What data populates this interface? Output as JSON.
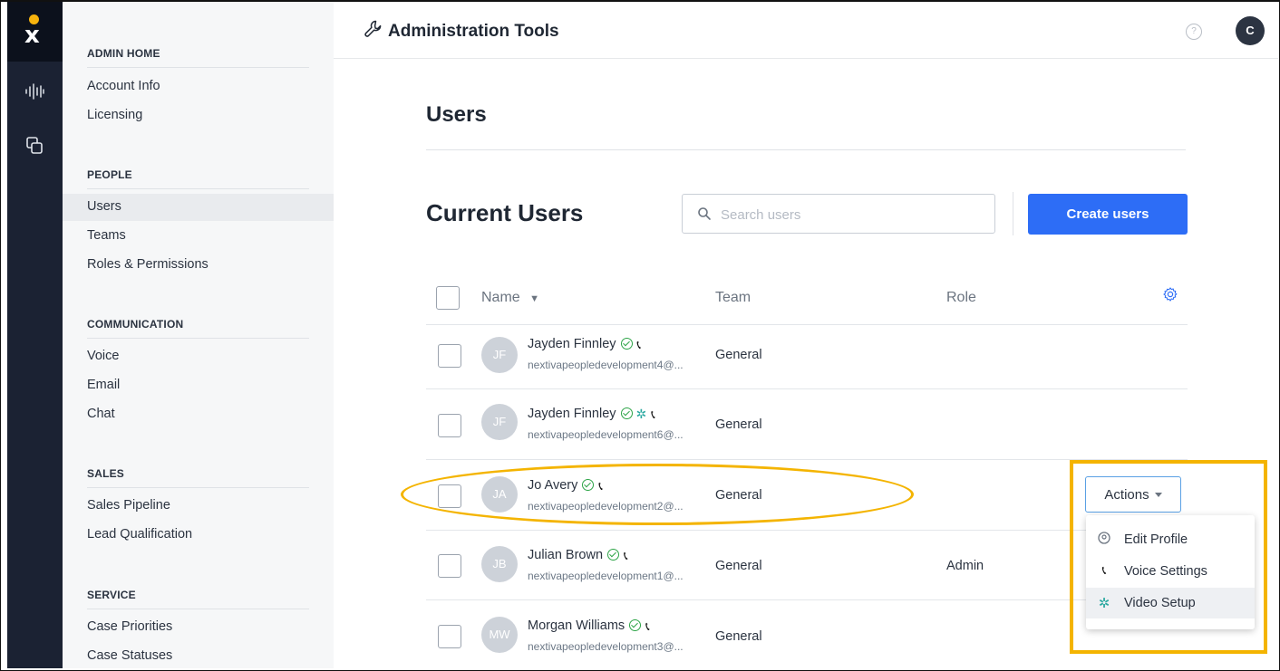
{
  "header": {
    "title": "Administration Tools",
    "help_icon": "?",
    "user_initial": "C"
  },
  "sidebar": {
    "sections": [
      {
        "title": "ADMIN HOME",
        "items": [
          "Account Info",
          "Licensing"
        ]
      },
      {
        "title": "PEOPLE",
        "items": [
          "Users",
          "Teams",
          "Roles & Permissions"
        ]
      },
      {
        "title": "COMMUNICATION",
        "items": [
          "Voice",
          "Email",
          "Chat"
        ]
      },
      {
        "title": "SALES",
        "items": [
          "Sales Pipeline",
          "Lead Qualification"
        ]
      },
      {
        "title": "SERVICE",
        "items": [
          "Case Priorities",
          "Case Statuses"
        ]
      }
    ],
    "active_item": "Users"
  },
  "main": {
    "page_title": "Users",
    "section_title": "Current Users",
    "search": {
      "placeholder": "Search users",
      "value": ""
    },
    "create_button": "Create users",
    "columns": {
      "name": "Name",
      "team": "Team",
      "role": "Role"
    },
    "users": [
      {
        "initials": "JF",
        "name": "Jayden Finnley",
        "email": "nextivapeopledevelopment4@...",
        "team": "General",
        "role": "",
        "video": false
      },
      {
        "initials": "JF",
        "name": "Jayden Finnley",
        "email": "nextivapeopledevelopment6@...",
        "team": "General",
        "role": "",
        "video": true
      },
      {
        "initials": "JA",
        "name": "Jo Avery",
        "email": "nextivapeopledevelopment2@...",
        "team": "General",
        "role": "",
        "video": false
      },
      {
        "initials": "JB",
        "name": "Julian Brown",
        "email": "nextivapeopledevelopment1@...",
        "team": "General",
        "role": "Admin",
        "video": false
      },
      {
        "initials": "MW",
        "name": "Morgan Williams",
        "email": "nextivapeopledevelopment3@...",
        "team": "General",
        "role": "",
        "video": false
      }
    ],
    "actions": {
      "label": "Actions",
      "menu": [
        "Edit Profile",
        "Voice Settings",
        "Video Setup"
      ]
    }
  },
  "colors": {
    "primary": "#2d6df6",
    "highlight": "#f4b400",
    "rail": "#1b2233",
    "status_ok": "#2da447"
  }
}
